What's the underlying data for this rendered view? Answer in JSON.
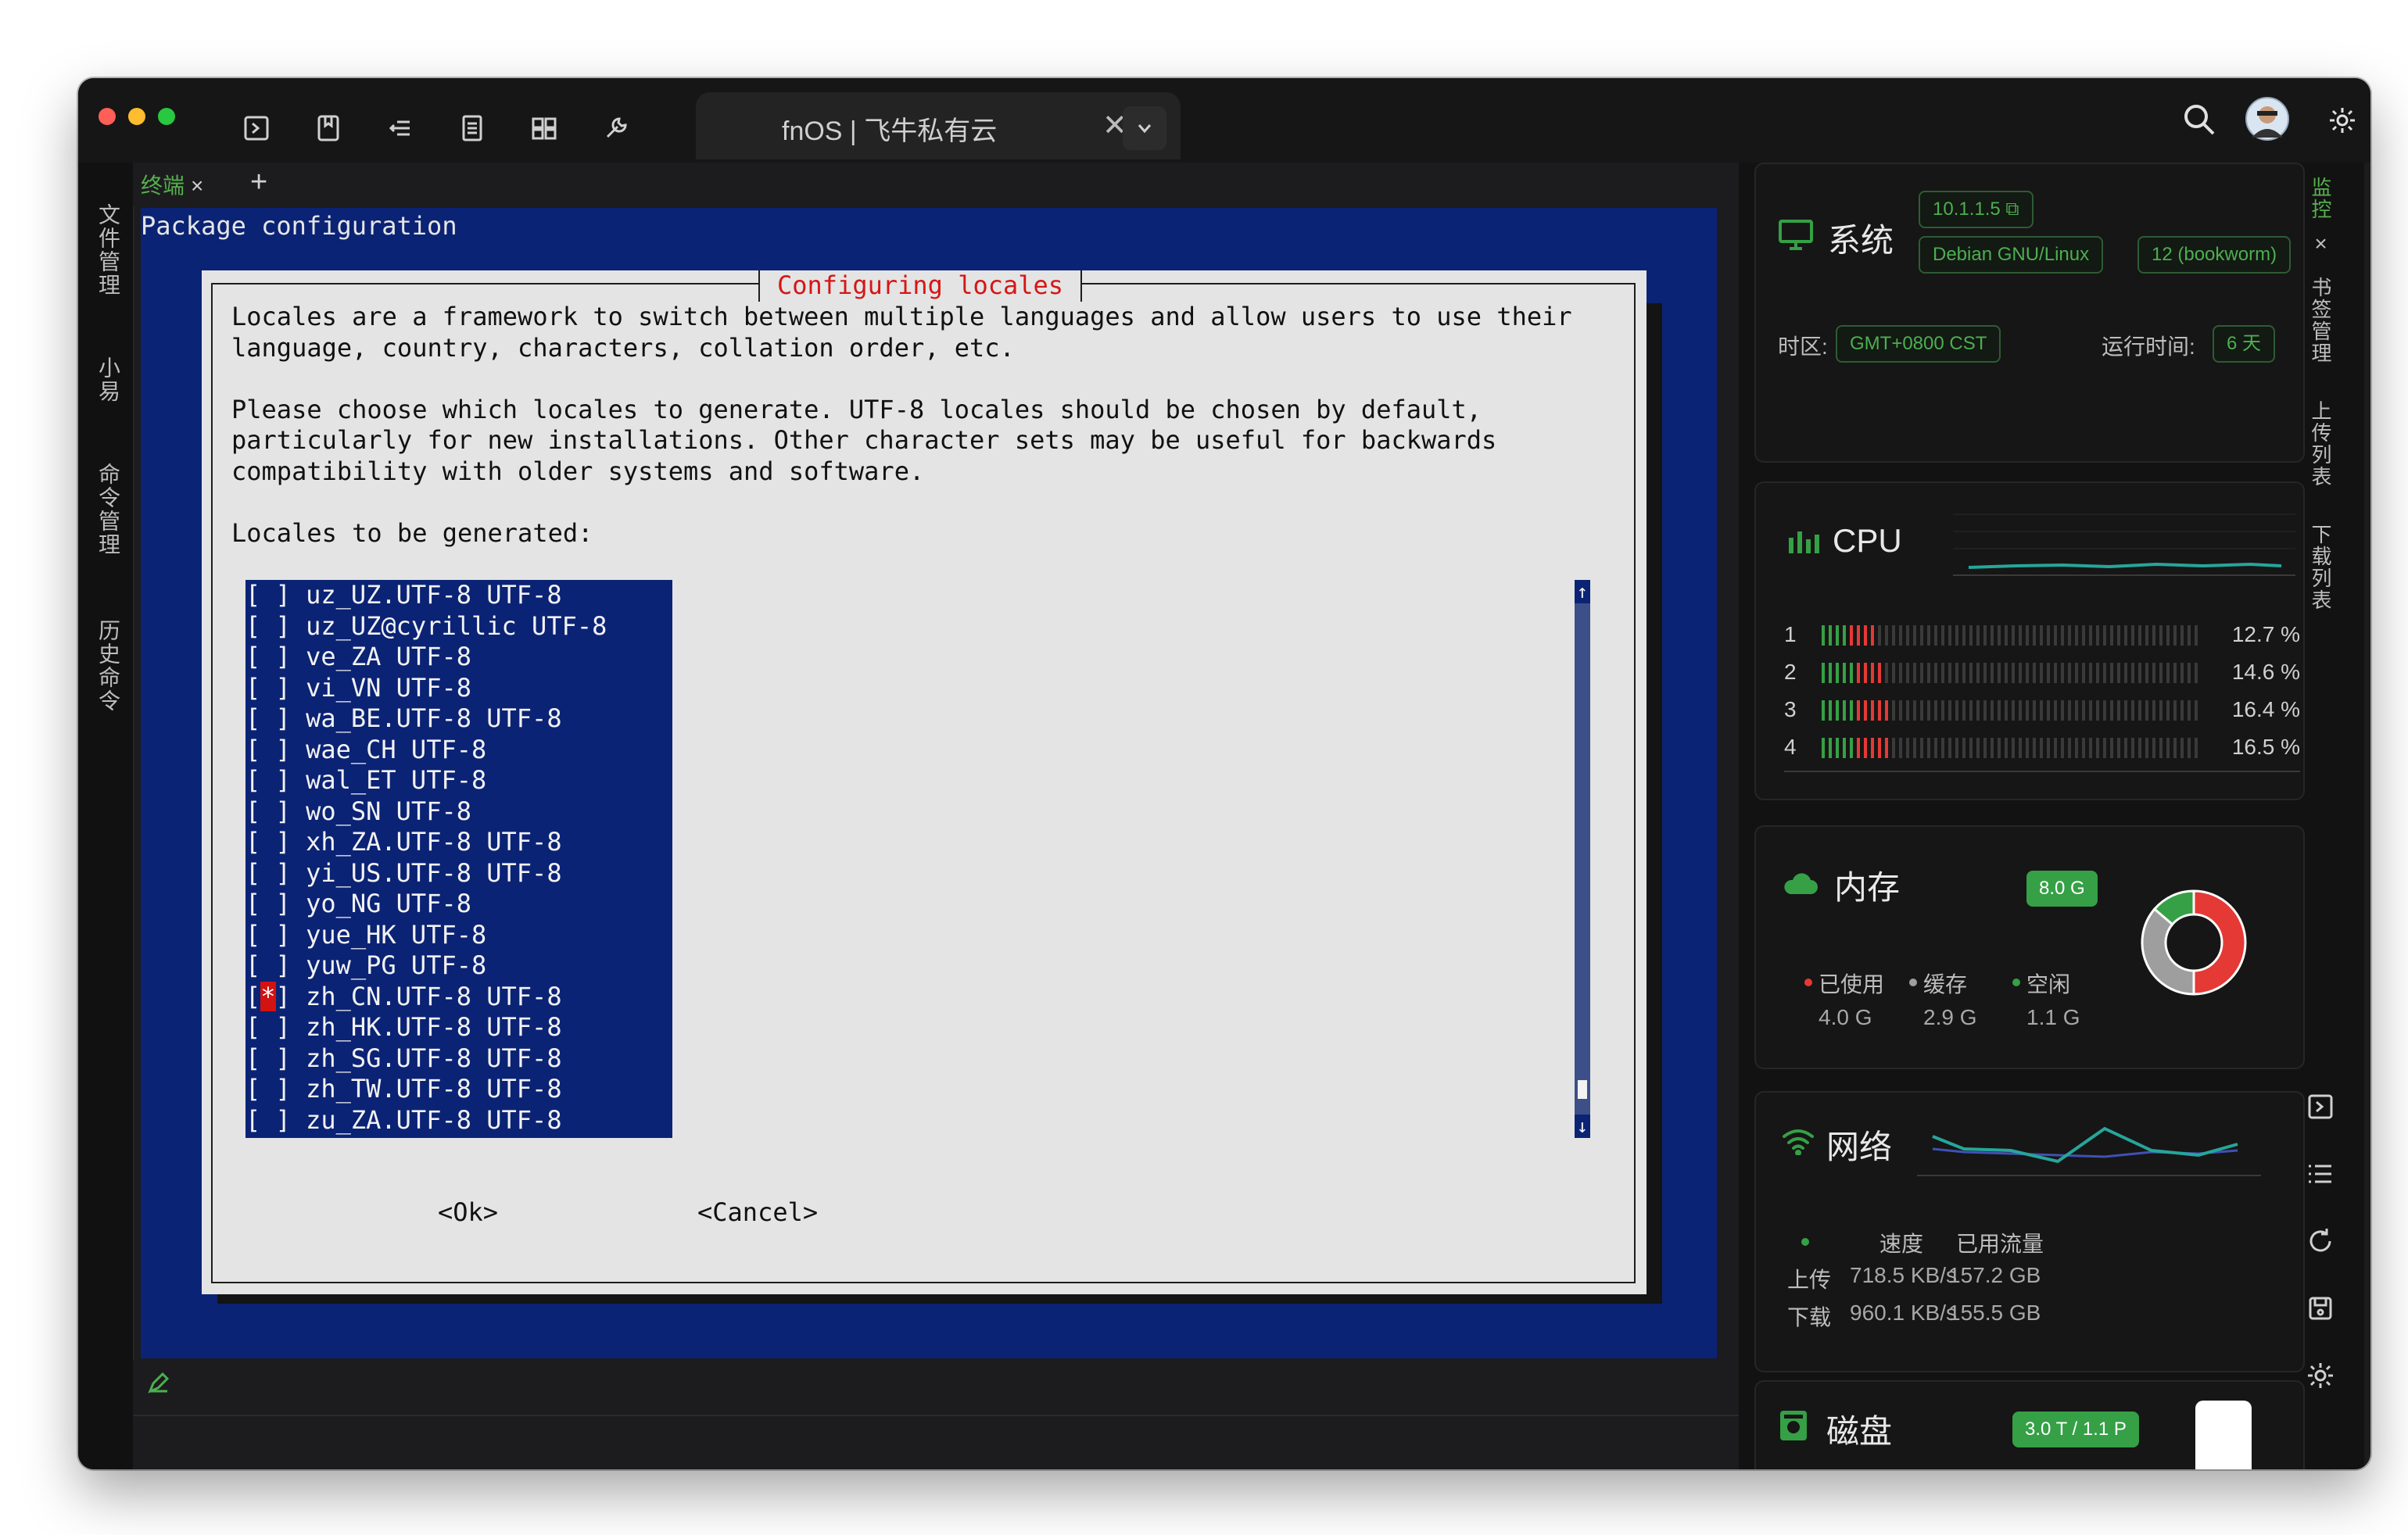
{
  "window": {
    "tab_title": "fnOS | 飞牛私有云",
    "tab_close": "✕"
  },
  "toolbar_icons": [
    "terminal-icon",
    "bookmark-icon",
    "sftp-icon",
    "file-icon",
    "layout-icon",
    "wrench-icon"
  ],
  "left_sidebar": {
    "items": [
      "文件管理",
      "小易",
      "命令管理",
      "历史命令"
    ]
  },
  "terminal_tabs": {
    "active_label": "终端",
    "close": "×",
    "add": "+",
    "close_pane": "×"
  },
  "terminal": {
    "header": "Package configuration",
    "dialog_title": "Configuring locales",
    "body_lines": [
      "Locales are a framework to switch between multiple languages and allow users to use their",
      "language, country, characters, collation order, etc.",
      "",
      "Please choose which locales to generate. UTF-8 locales should be chosen by default,",
      "particularly for new installations. Other character sets may be useful for backwards",
      "compatibility with older systems and software.",
      "",
      "Locales to be generated:"
    ],
    "locales": [
      {
        "mark": " ",
        "name": "uz_UZ.UTF-8 UTF-8"
      },
      {
        "mark": " ",
        "name": "uz_UZ@cyrillic UTF-8"
      },
      {
        "mark": " ",
        "name": "ve_ZA UTF-8"
      },
      {
        "mark": " ",
        "name": "vi_VN UTF-8"
      },
      {
        "mark": " ",
        "name": "wa_BE.UTF-8 UTF-8"
      },
      {
        "mark": " ",
        "name": "wae_CH UTF-8"
      },
      {
        "mark": " ",
        "name": "wal_ET UTF-8"
      },
      {
        "mark": " ",
        "name": "wo_SN UTF-8"
      },
      {
        "mark": " ",
        "name": "xh_ZA.UTF-8 UTF-8"
      },
      {
        "mark": " ",
        "name": "yi_US.UTF-8 UTF-8"
      },
      {
        "mark": " ",
        "name": "yo_NG UTF-8"
      },
      {
        "mark": " ",
        "name": "yue_HK UTF-8"
      },
      {
        "mark": " ",
        "name": "yuw_PG UTF-8"
      },
      {
        "mark": "*",
        "name": "zh_CN.UTF-8 UTF-8"
      },
      {
        "mark": " ",
        "name": "zh_HK.UTF-8 UTF-8"
      },
      {
        "mark": " ",
        "name": "zh_SG.UTF-8 UTF-8"
      },
      {
        "mark": " ",
        "name": "zh_TW.UTF-8 UTF-8"
      },
      {
        "mark": " ",
        "name": "zu_ZA.UTF-8 UTF-8"
      }
    ],
    "scroll_up": "↑",
    "scroll_down": "↓",
    "ok_button": "<Ok>",
    "cancel_button": "<Cancel>"
  },
  "system": {
    "title": "系统",
    "version": "10.1.1.5",
    "os": "Debian GNU/Linux",
    "release": "12 (bookworm)",
    "timezone_label": "时区:",
    "timezone": "GMT+0800  CST",
    "uptime_label": "运行时间:",
    "uptime": "6 天"
  },
  "cpu": {
    "title": "CPU",
    "cores": [
      {
        "id": "1",
        "pct_text": "12.7 %",
        "pct": 12.7
      },
      {
        "id": "2",
        "pct_text": "14.6 %",
        "pct": 14.6
      },
      {
        "id": "3",
        "pct_text": "16.4 %",
        "pct": 16.4
      },
      {
        "id": "4",
        "pct_text": "16.5 %",
        "pct": 16.5
      }
    ]
  },
  "memory": {
    "title": "内存",
    "total": "8.0 G",
    "used_label": "已使用",
    "cache_label": "缓存",
    "free_label": "空闲",
    "used": "4.0 G",
    "cache": "2.9 G",
    "free": "1.1 G",
    "donut": {
      "used": 4.0,
      "cache": 2.9,
      "free": 1.1
    }
  },
  "network": {
    "title": "网络",
    "col_speed": "速度",
    "col_traffic": "已用流量",
    "upload_label": "上传",
    "download_label": "下载",
    "up_speed": "718.5 KB/s",
    "down_speed": "960.1 KB/s",
    "up_traffic": "157.2 GB",
    "down_traffic": "155.5 GB"
  },
  "disk": {
    "title": "磁盘",
    "size": "3.0 T / 1.1 P"
  },
  "right_sidebar": {
    "tabs": [
      "监控",
      "书签管理",
      "上传列表",
      "下载列表"
    ],
    "close": "×"
  },
  "colors": {
    "terminal_bg": "#0b2375",
    "dialog_bg": "#e4e4e4",
    "accent_green": "#35a045",
    "used_red": "#e53935",
    "cache_gray": "#9e9e9e"
  }
}
